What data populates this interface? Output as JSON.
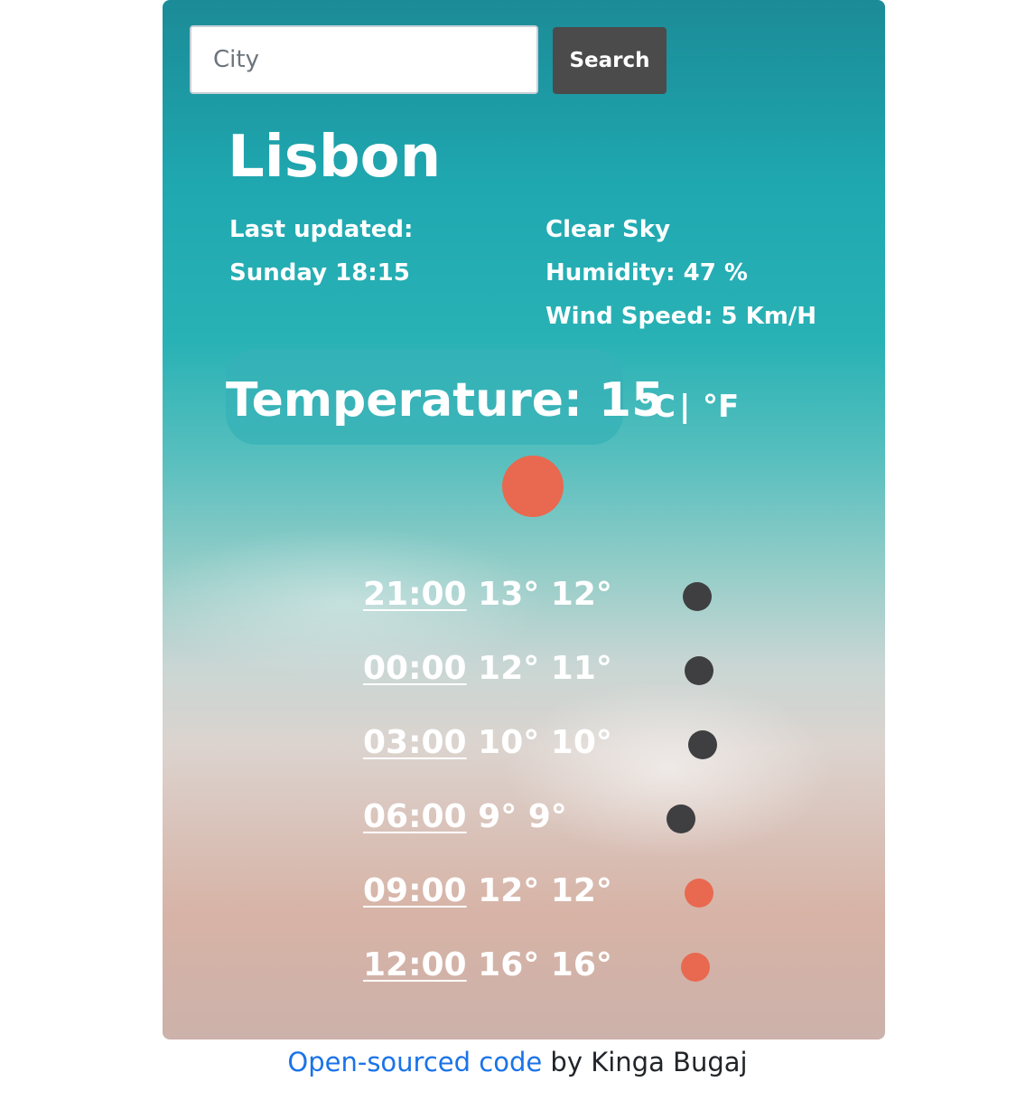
{
  "search": {
    "placeholder": "City",
    "button_label": "Search"
  },
  "weather": {
    "city": "Lisbon",
    "last_updated_label": "Last updated:",
    "last_updated_value": "Sunday 18:15",
    "description": "Clear Sky",
    "humidity": "Humidity: 47 %",
    "wind_speed": "Wind Speed: 5 Km/H",
    "temperature_label": "Temperature: 15",
    "unit_celsius": "°C",
    "unit_separator": "|",
    "unit_fahrenheit": "°F",
    "current_icon": "sun-icon",
    "current_icon_color": "#e8694f"
  },
  "forecast": [
    {
      "time": "21:00",
      "temps": "13° 12°",
      "icon": "night-icon",
      "color": "#3f3f41"
    },
    {
      "time": "00:00",
      "temps": "12° 11°",
      "icon": "night-icon",
      "color": "#3f3f41"
    },
    {
      "time": "03:00",
      "temps": "10° 10°",
      "icon": "night-icon",
      "color": "#3f3f41"
    },
    {
      "time": "06:00",
      "temps": "9° 9°",
      "icon": "night-icon",
      "color": "#3f3f41"
    },
    {
      "time": "09:00",
      "temps": "12° 12°",
      "icon": "sun-icon",
      "color": "#e8694f"
    },
    {
      "time": "12:00",
      "temps": "16° 16°",
      "icon": "sun-icon",
      "color": "#e8694f"
    }
  ],
  "footer": {
    "link_text": "Open-sourced code",
    "suffix": " by Kinga Bugaj"
  }
}
